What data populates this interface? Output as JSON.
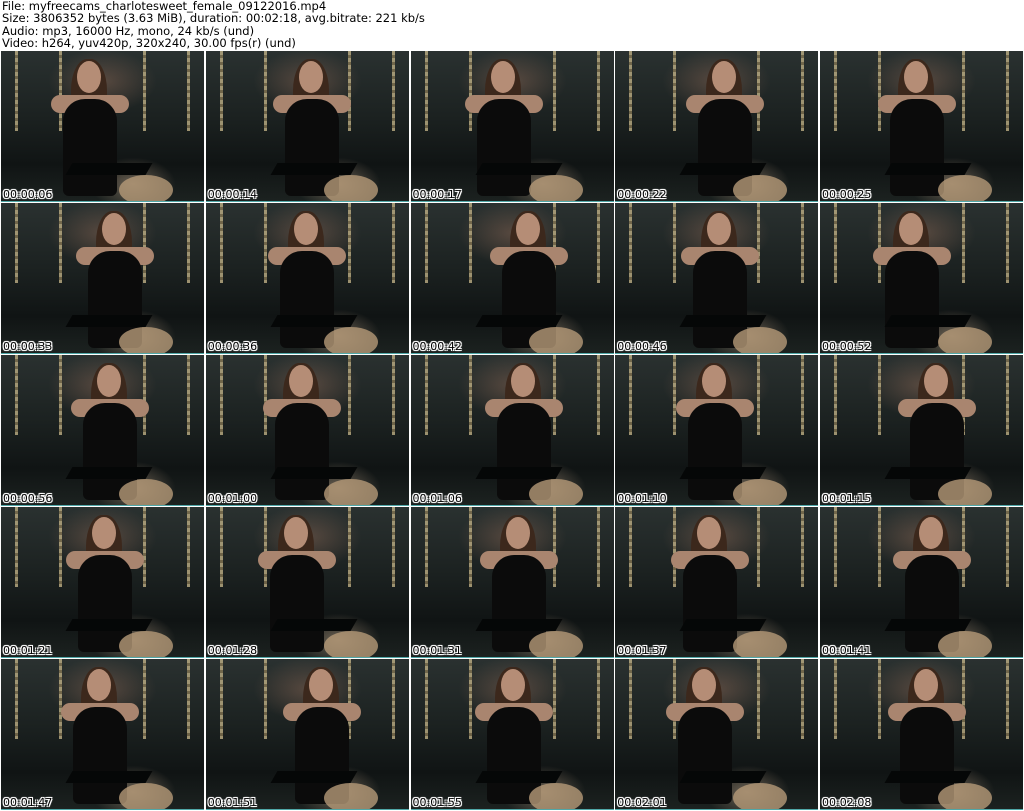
{
  "header": {
    "file_line": "File: myfreecams_charlotesweet_female_09122016.mp4",
    "size_line": "Size: 3806352 bytes (3.63 MiB), duration: 00:02:18, avg.bitrate: 221 kb/s",
    "audio_line": "Audio: mp3, 16000 Hz, mono, 24 kb/s (und)",
    "video_line": "Video: h264, yuv420p, 320x240, 30.00 fps(r) (und)"
  },
  "thumbnails": [
    {
      "timestamp": "00:00:06"
    },
    {
      "timestamp": "00:00:14"
    },
    {
      "timestamp": "00:00:17"
    },
    {
      "timestamp": "00:00:22"
    },
    {
      "timestamp": "00:00:25"
    },
    {
      "timestamp": "00:00:33"
    },
    {
      "timestamp": "00:00:36"
    },
    {
      "timestamp": "00:00:42"
    },
    {
      "timestamp": "00:00:46"
    },
    {
      "timestamp": "00:00:52"
    },
    {
      "timestamp": "00:00:56"
    },
    {
      "timestamp": "00:01:00"
    },
    {
      "timestamp": "00:01:06"
    },
    {
      "timestamp": "00:01:10"
    },
    {
      "timestamp": "00:01:15"
    },
    {
      "timestamp": "00:01:21"
    },
    {
      "timestamp": "00:01:28"
    },
    {
      "timestamp": "00:01:31"
    },
    {
      "timestamp": "00:01:37"
    },
    {
      "timestamp": "00:01:41"
    },
    {
      "timestamp": "00:01:47"
    },
    {
      "timestamp": "00:01:51"
    },
    {
      "timestamp": "00:01:55"
    },
    {
      "timestamp": "00:02:01"
    },
    {
      "timestamp": "00:02:08"
    }
  ],
  "colors": {
    "row_separator": "#4fa8a8",
    "background": "#ffffff"
  }
}
